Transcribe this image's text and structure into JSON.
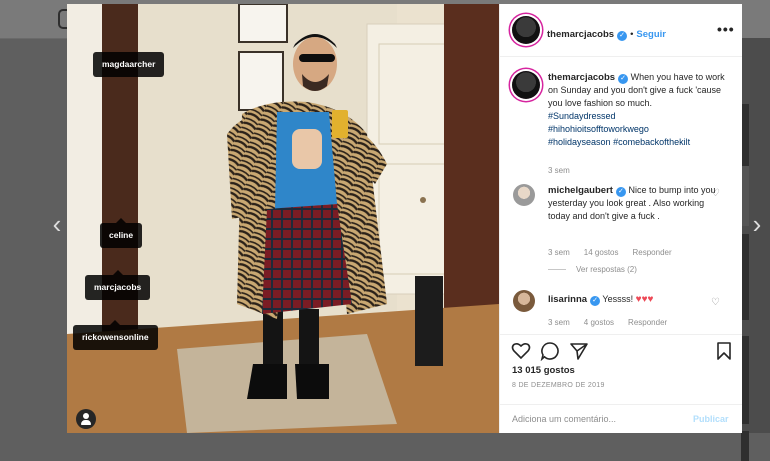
{
  "post": {
    "account": "themarcjacobs",
    "follow_label": "Seguir",
    "separator": "•",
    "more_label": "•••",
    "caption_user": "themarcjacobs",
    "caption_text": "When you have to work on Sunday and you don't give a fuck 'cause you love fashion so much.",
    "hashtags": [
      "#Sundaydressed",
      "#hihohioitsofftoworkwego",
      "#holidayseason",
      "#comebackofthekilt"
    ],
    "caption_time": "3 sem",
    "likes": "13 015 gostos",
    "date": "8 DE DEZEMBRO DE 2019",
    "add_comment_placeholder": "Adiciona um comentário...",
    "publish_label": "Publicar"
  },
  "tags": {
    "t1": "magdaarcher",
    "t2": "celine",
    "t3": "marcjacobs",
    "t4": "rickowensonline"
  },
  "comments": [
    {
      "user": "michelgaubert",
      "text": "Nice to bump into you yesterday you look great . Also working today and don't give a fuck .",
      "time": "3 sem",
      "likes": "14 gostos",
      "reply": "Responder",
      "view_replies": "Ver respostas (2)"
    },
    {
      "user": "lisarinna",
      "text": "Yessss!",
      "time": "3 sem",
      "likes": "4 gostos",
      "reply": "Responder"
    }
  ],
  "nav": {
    "prev": "‹",
    "next": "›"
  },
  "colors": {
    "link": "#3897f0",
    "hashtag": "#003569",
    "heart": "#ed4956"
  }
}
